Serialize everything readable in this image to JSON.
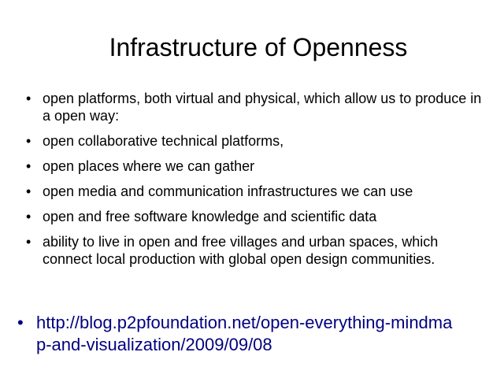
{
  "slide": {
    "title": "Infrastructure of Openness",
    "bullets": [
      "open platforms, both virtual and physical, which allow us to produce in a open way:",
      "open collaborative technical platforms,",
      "open places where we can gather",
      "open media and communication infrastructures we can use",
      "open and free software knowledge and scientific data",
      "ability to live in open and free villages and urban spaces, which connect local production with global open design communities."
    ],
    "bullet_glyph": "•",
    "link_line1": "http://blog.p2pfoundation.net/open-everything-mindmap-and-visualization/2009/09/08",
    "link_line1_visible": "http://blog.p2pfoundation.net/open-everything-mindma",
    "link_line2_visible": "p-and-visualization/2009/09/08"
  },
  "colors": {
    "text": "#000000",
    "link": "#000080",
    "background": "#ffffff"
  }
}
